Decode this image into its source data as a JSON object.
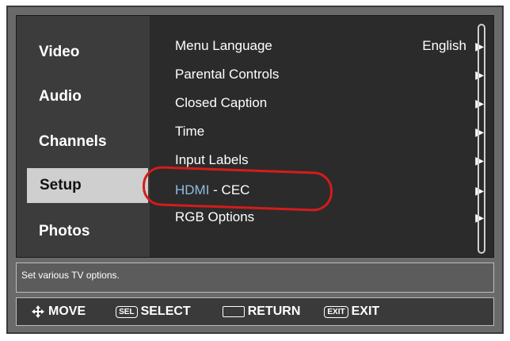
{
  "sidebar": {
    "items": [
      {
        "label": "Video"
      },
      {
        "label": "Audio"
      },
      {
        "label": "Channels"
      },
      {
        "label": "Setup",
        "selected": true
      },
      {
        "label": "Photos"
      }
    ]
  },
  "menu": {
    "rows": [
      {
        "label": "Menu Language",
        "value": "English",
        "arrow": "▶"
      },
      {
        "label": "Parental Controls",
        "arrow": "▶"
      },
      {
        "label": "Closed Caption",
        "arrow": "▶"
      },
      {
        "label": "Time",
        "arrow": "▶"
      },
      {
        "label": "Input Labels",
        "arrow": "▶"
      },
      {
        "label_part1": "HDMI",
        "label_part2": " - CEC",
        "arrow": "▶"
      },
      {
        "label": "RGB Options",
        "arrow": "▶"
      }
    ]
  },
  "help_text": "Set various TV options.",
  "footer": {
    "move": "MOVE",
    "sel_key": "SEL",
    "select": "SELECT",
    "return": "RETURN",
    "exit_key": "EXIT",
    "exit": "EXIT"
  },
  "colors": {
    "annotation": "#d41c1c",
    "hdmi_accent": "#8fbde0"
  }
}
